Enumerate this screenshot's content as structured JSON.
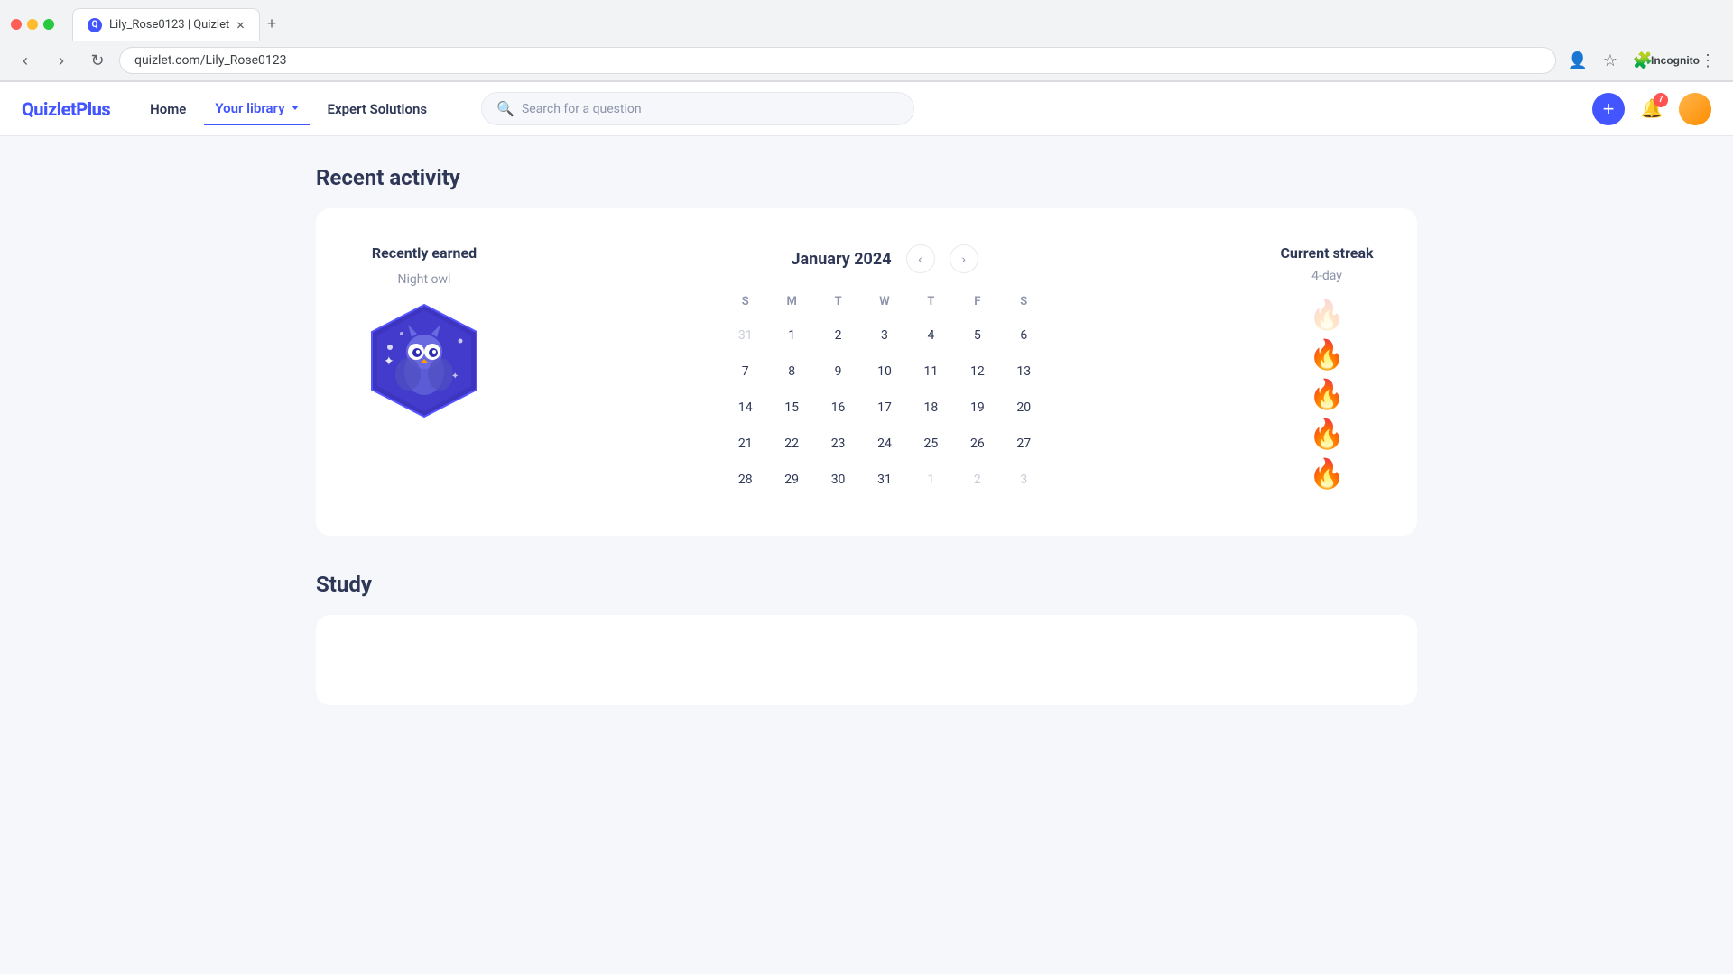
{
  "browser": {
    "tab_title": "Lily_Rose0123 | Quizlet",
    "url": "quizlet.com/Lily_Rose0123",
    "new_tab_label": "+"
  },
  "nav": {
    "logo": "QuizletPlus",
    "home_label": "Home",
    "library_label": "Your library",
    "solutions_label": "Expert Solutions",
    "search_placeholder": "Search for a question",
    "notif_count": "7"
  },
  "recent_activity": {
    "section_title": "Recent activity",
    "recently_earned_title": "Recently earned",
    "badge_name": "Night owl",
    "calendar_month": "January 2024",
    "day_labels": [
      "S",
      "M",
      "T",
      "W",
      "T",
      "F",
      "S"
    ],
    "weeks": [
      [
        "31",
        "1",
        "2",
        "3",
        "4",
        "5",
        "6"
      ],
      [
        "7",
        "8",
        "9",
        "10",
        "11",
        "12",
        "13"
      ],
      [
        "14",
        "15",
        "16",
        "17",
        "18",
        "19",
        "20"
      ],
      [
        "21",
        "22",
        "23",
        "24",
        "25",
        "26",
        "27"
      ],
      [
        "28",
        "29",
        "30",
        "31",
        "1",
        "2",
        "3"
      ]
    ],
    "other_month_indices": {
      "0": [
        0
      ],
      "4": [
        4,
        5,
        6
      ]
    },
    "streak_title": "Current streak",
    "streak_value": "4-day",
    "streak_flames": 4,
    "streak_empty": 1
  },
  "study": {
    "section_title": "Study"
  }
}
